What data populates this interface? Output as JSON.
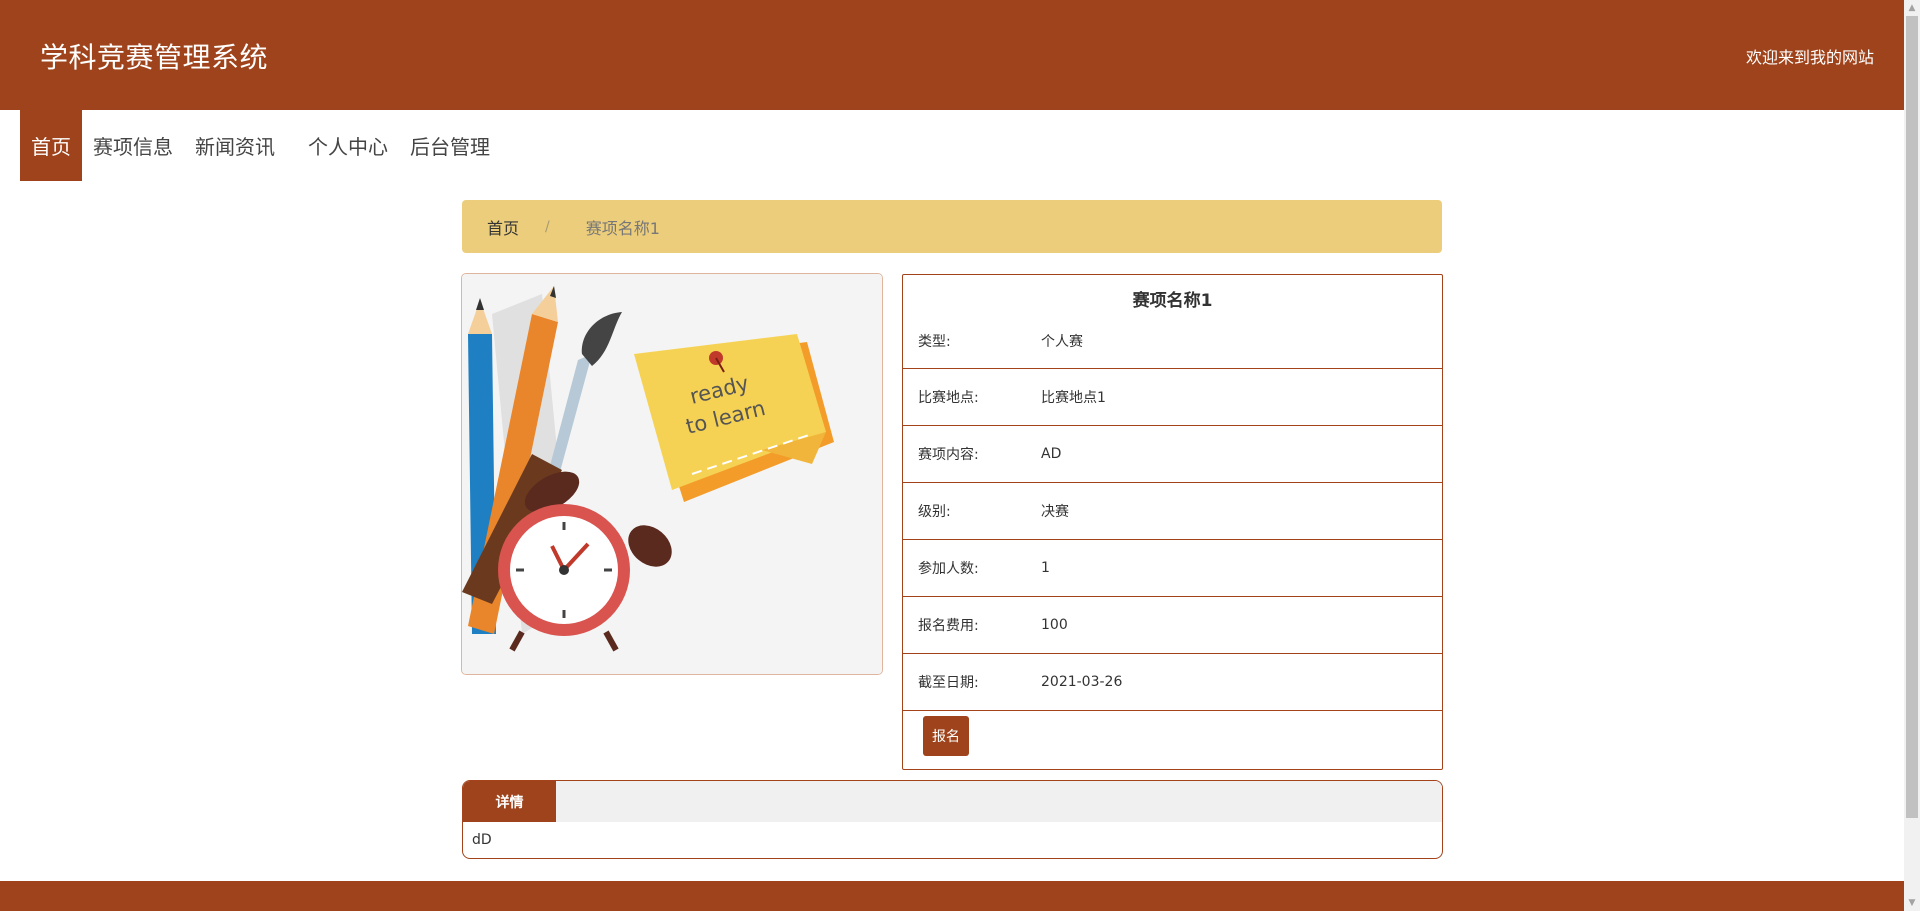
{
  "header": {
    "title": "学科竞赛管理系统",
    "welcome": "欢迎来到我的网站"
  },
  "nav": {
    "items": [
      {
        "label": "首页",
        "active": true
      },
      {
        "label": "赛项信息",
        "active": false
      },
      {
        "label": "新闻资讯",
        "active": false
      },
      {
        "label": "个人中心",
        "active": false
      },
      {
        "label": "后台管理",
        "active": false
      }
    ]
  },
  "breadcrumb": {
    "home": "首页",
    "separator": "/",
    "current": "赛项名称1"
  },
  "image": {
    "text_line1": "ready",
    "text_line2": "to learn"
  },
  "info": {
    "title": "赛项名称1",
    "rows": [
      {
        "label": "类型:",
        "value": "个人赛"
      },
      {
        "label": "比赛地点:",
        "value": "比赛地点1"
      },
      {
        "label": "赛项内容:",
        "value": "AD"
      },
      {
        "label": "级别:",
        "value": "决赛"
      },
      {
        "label": "参加人数:",
        "value": "1"
      },
      {
        "label": "报名费用:",
        "value": "100"
      },
      {
        "label": "截至日期:",
        "value": "2021-03-26"
      }
    ],
    "signup_label": "报名"
  },
  "details": {
    "tab_label": "详情",
    "content": "dD"
  },
  "colors": {
    "primary": "#9e431b",
    "breadcrumb_bg": "#ebcd7b",
    "tab_bar_bg": "#f0f0f0"
  },
  "scrollbar": {
    "up_icon": "▲",
    "down_icon": "▼"
  }
}
